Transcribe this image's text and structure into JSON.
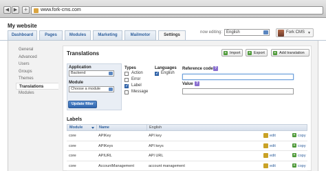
{
  "browser": {
    "back_label": "◀",
    "forward_label": "▶",
    "add_label": "+",
    "url": "www.fork-cms.com"
  },
  "site": {
    "title": "My website"
  },
  "top_tabs": [
    "Dashboard",
    "Pages",
    "Modules",
    "Marketing",
    "Mailmotor",
    "Settings"
  ],
  "header": {
    "editing_label": "now editing:",
    "language": "English",
    "user_name": "Fork CMS",
    "user_caret": "▼"
  },
  "sidebar": {
    "items": [
      "General",
      "Advanced",
      "Users",
      "Groups",
      "Themes",
      "Translations",
      "Modules"
    ],
    "active_index": 5
  },
  "translations": {
    "title": "Translations",
    "import_label": "Import",
    "export_label": "Export",
    "add_label": "Add translation",
    "application_label": "Application",
    "application_value": "Backend",
    "module_label": "Module",
    "module_value": "Choose a module",
    "update_label": "Update filter",
    "types_label": "Types",
    "types": [
      {
        "label": "Action",
        "checked": false
      },
      {
        "label": "Error",
        "checked": false
      },
      {
        "label": "Label",
        "checked": true
      },
      {
        "label": "Message",
        "checked": false
      }
    ],
    "languages_label": "Languages",
    "languages": [
      {
        "label": "English",
        "checked": true
      }
    ],
    "reference_label": "Reference code",
    "value_label": "Value",
    "help_glyph": "?",
    "reference_value": "",
    "value_value": ""
  },
  "labels_table": {
    "title": "Labels",
    "columns": [
      "Module",
      "Name",
      "English"
    ],
    "edit_label": "edit",
    "copy_label": "copy",
    "rows": [
      {
        "module": "core",
        "name": "APIKey",
        "english": "API key"
      },
      {
        "module": "core",
        "name": "APIKeys",
        "english": "API keys"
      },
      {
        "module": "core",
        "name": "APIURL",
        "english": "API URL"
      },
      {
        "module": "core",
        "name": "AccountManagement",
        "english": "account management"
      }
    ]
  },
  "colors": {
    "accent_blue": "#2e5f9c",
    "button_green": "#4f9a3a",
    "help_purple": "#8a6fd0"
  }
}
